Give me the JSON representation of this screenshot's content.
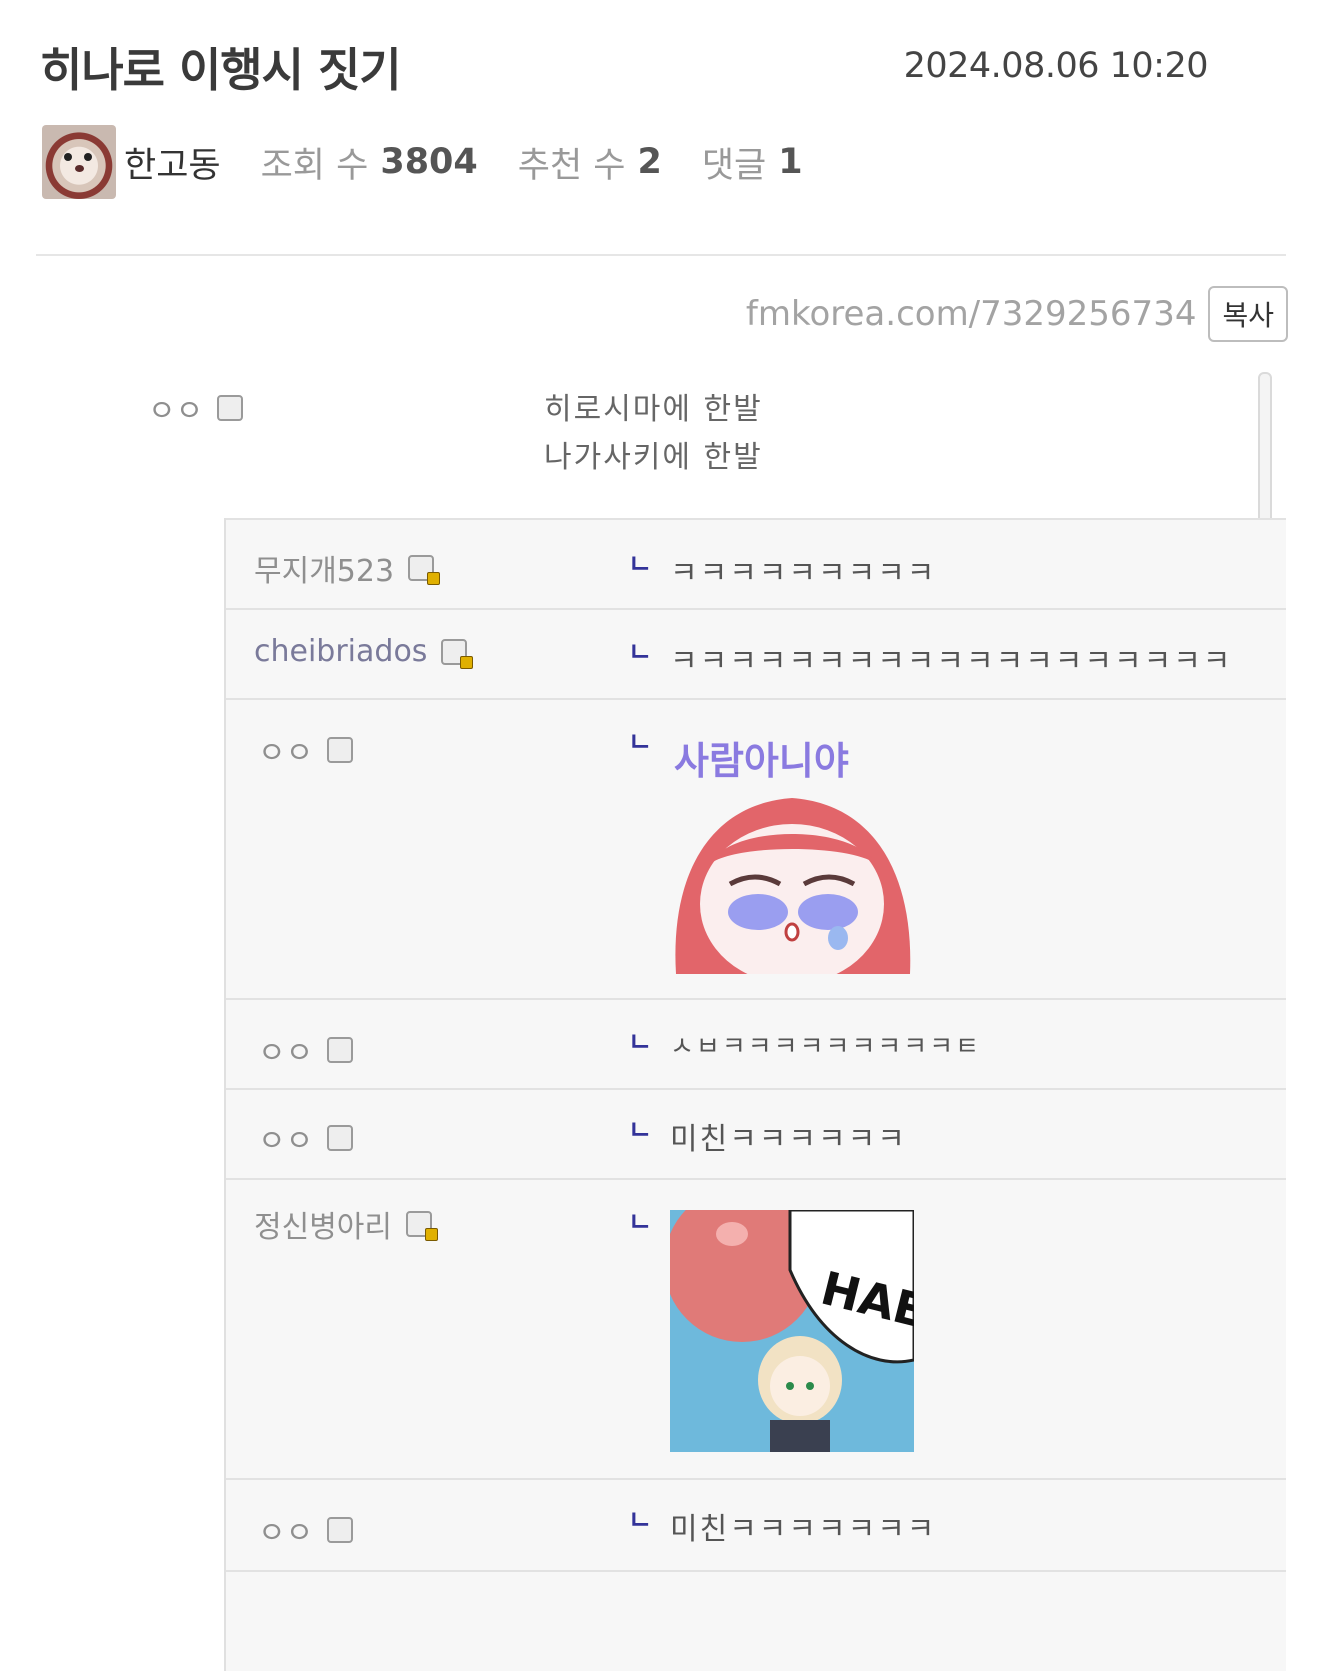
{
  "post": {
    "title": "히나로 이행시 짓기",
    "datetime": "2024.08.06 10:20",
    "author": "한고동",
    "views_label": "조회 수",
    "views": "3804",
    "likes_label": "추천 수",
    "likes": "2",
    "comments_label": "댓글",
    "comments": "1",
    "url": "fmkorea.com/7329256734",
    "copy_label": "복사"
  },
  "screenshot": {
    "op_nick": "ㅇㅇ",
    "op_line1": "히로시마에 한발",
    "op_line2": "나가사키에 한발",
    "reply_mark": "ㄴ",
    "replies": [
      {
        "nick": "무지개523",
        "text": "ㅋㅋㅋㅋㅋㅋㅋㅋㅋ"
      },
      {
        "nick": "cheibriados",
        "text": "ㅋㅋㅋㅋㅋㅋㅋㅋㅋㅋㅋㅋㅋㅋㅋㅋㅋㅋㅋ"
      },
      {
        "nick": "ㅇㅇ",
        "sticker_text": "사람아니야"
      },
      {
        "nick": "ㅇㅇ",
        "text": "ㅅㅂㅋㅋㅋㅋㅋㅋㅋㅋㅋㅌ"
      },
      {
        "nick": "ㅇㅇ",
        "text": "미친ㅋㅋㅋㅋㅋㅋ"
      },
      {
        "nick": "정신병아리",
        "sticker_text": "HAE"
      },
      {
        "nick": "ㅇㅇ",
        "text": "미친ㅋㅋㅋㅋㅋㅋㅋ"
      }
    ]
  }
}
